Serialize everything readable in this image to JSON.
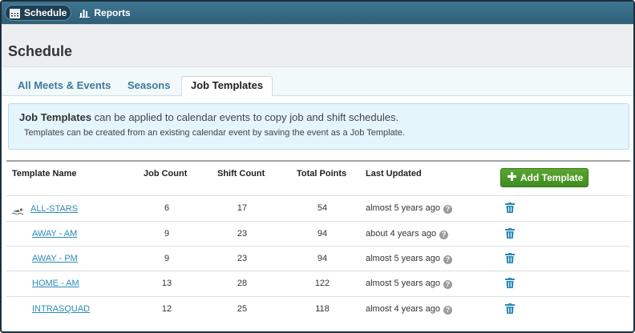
{
  "topnav": {
    "items": [
      {
        "label": "Schedule",
        "icon": "calendar-icon",
        "active": true
      },
      {
        "label": "Reports",
        "icon": "bar-chart-icon",
        "active": false
      }
    ]
  },
  "page": {
    "title": "Schedule"
  },
  "tabs": [
    {
      "label": "All Meets & Events",
      "active": false
    },
    {
      "label": "Seasons",
      "active": false
    },
    {
      "label": "Job Templates",
      "active": true
    }
  ],
  "info": {
    "bold": "Job Templates",
    "rest": " can be applied to calendar events to copy job and shift schedules.",
    "line2": "Templates can be created from an existing calendar event by saving the event as a Job Template."
  },
  "table": {
    "headers": {
      "name": "Template Name",
      "jobs": "Job Count",
      "shifts": "Shift Count",
      "points": "Total Points",
      "updated": "Last Updated"
    },
    "add_label": "Add Template",
    "rows": [
      {
        "name": "ALL-STARS",
        "jobs": "6",
        "shifts": "17",
        "points": "54",
        "updated": "almost 5 years ago",
        "icon": "swimmer-icon"
      },
      {
        "name": "AWAY - AM",
        "jobs": "9",
        "shifts": "23",
        "points": "94",
        "updated": "about 4 years ago"
      },
      {
        "name": "AWAY - PM",
        "jobs": "9",
        "shifts": "23",
        "points": "94",
        "updated": "almost 5 years ago"
      },
      {
        "name": "HOME - AM",
        "jobs": "13",
        "shifts": "28",
        "points": "122",
        "updated": "almost 5 years ago"
      },
      {
        "name": "INTRASQUAD",
        "jobs": "12",
        "shifts": "25",
        "points": "118",
        "updated": "almost 4 years ago"
      }
    ]
  },
  "colors": {
    "accent": "#2a8ab8",
    "add_button": "#4a9a28",
    "topbar": "#33647e"
  }
}
